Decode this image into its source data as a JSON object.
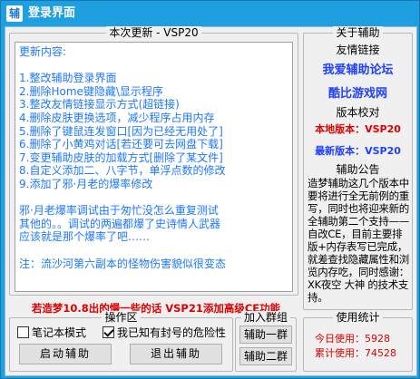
{
  "window": {
    "icon_char": "辅",
    "title": "登录界面"
  },
  "update": {
    "title": "本次更新 - VSP20",
    "lines": [
      "更新内容:",
      "",
      "1.整改辅助登录界面",
      "2.删除Home键隐藏\\显示程序",
      "3.整改友情链接显示方式(超链接)",
      "4.删除皮肤更换选项，减少程序占用内存",
      "5.删除了键鼠连发窗口[因为已经无用处了]",
      "6.删除了小黄鸡对话[若还要可去网盘下载]",
      "7.变更辅助皮肤的加载方式[删除了某文件]",
      "8.自定义添加二、八字节，单浮点数的修改",
      "9.添加了邪·月老的爆率修改",
      "",
      "邪·月老爆率调试由于匆忙没怎么重复测试",
      "其他的。。调试的两遍都爆了史诗情人武器",
      "应该就是那个爆率了吧……",
      "",
      "注：流沙河第六副本的怪物伤害貌似很变态"
    ]
  },
  "about": {
    "title": "关于辅助",
    "links_label": "友情链接",
    "link1": "我爱辅助论坛",
    "link2": "酷比游戏网",
    "version_label": "版本校对",
    "local_version": "本地版本：VSP20",
    "latest_version": "最新版本：VSP20",
    "notice_label": "辅助公告",
    "notice_text": "造梦辅助这几个版本中要将进行全无前例的重写，同时也将迎来新的全辅助第二个支持——自改CE，目前主要排版+内存表写已完成，就差查找隐藏属性和浏览内存吃，同时感谢：XK夜空 大神 的技术支持。"
  },
  "promo": "若造梦10.8出的慢一些的话 VSP21添加高级CE功能",
  "ops": {
    "title": "操作区",
    "notebook_mode": "笔记本模式",
    "notebook_checked": false,
    "ban_known": "我已知有封号的危险性",
    "ban_checked": true,
    "start_button": "启动辅助",
    "exit_button": "退出辅助"
  },
  "join": {
    "title": "加入群组",
    "group1": "辅助一群",
    "group2": "辅助二群"
  },
  "stats": {
    "title": "使用统计",
    "today": "今日使用：5928",
    "total": "累计使用：74528"
  },
  "colors": {
    "titlebar": "#1ea0e0",
    "update_text": "#1e78ff",
    "link": "#2040ff",
    "local_version": "#e00000",
    "latest_version": "#2040ff",
    "promo": "#e00000",
    "stats": "#e00000"
  }
}
